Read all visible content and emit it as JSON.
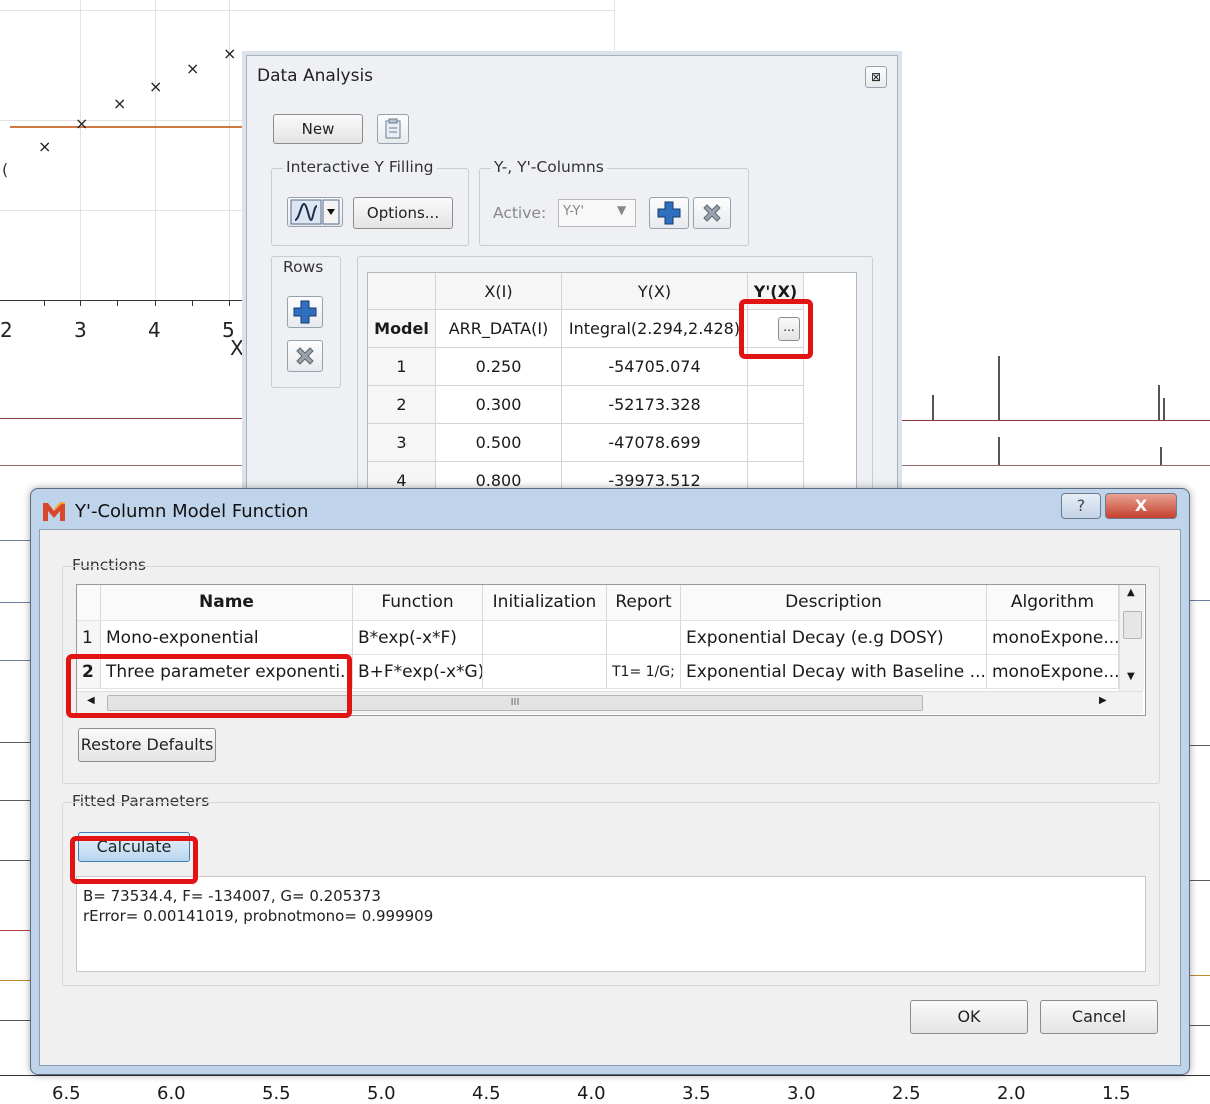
{
  "plot": {
    "x_tick_labels": [
      "2",
      "3",
      "4",
      "5"
    ],
    "x_axis_fragment": "X",
    "left_fragment": "(",
    "bottom_axis_labels": [
      "6.5",
      "6.0",
      "5.5",
      "5.0",
      "4.5",
      "4.0",
      "3.5",
      "3.0",
      "2.5",
      "2.0",
      "1.5"
    ]
  },
  "data_analysis": {
    "title": "Data Analysis",
    "new_button": "New",
    "interactive_y_label": "Interactive Y Filling",
    "options_button": "Options...",
    "yy_columns_label": "Y-, Y'-Columns",
    "active_label": "Active:",
    "active_value": "Y-Y'",
    "rows_label": "Rows",
    "table": {
      "headers": [
        "",
        "X(I)",
        "Y(X)",
        "Y'(X)"
      ],
      "model_row": [
        "Model",
        "ARR_DATA(I)",
        "Integral(2.294,2.428)",
        ""
      ],
      "rows": [
        [
          "1",
          "0.250",
          "-54705.074"
        ],
        [
          "2",
          "0.300",
          "-52173.328"
        ],
        [
          "3",
          "0.500",
          "-47078.699"
        ],
        [
          "4",
          "0.800",
          "-39973.512"
        ]
      ],
      "ellipsis": "..."
    }
  },
  "model_function": {
    "title": "Y'-Column Model Function",
    "help": "?",
    "close": "X",
    "functions_label": "Functions",
    "columns": [
      "Name",
      "Function",
      "Initialization",
      "Report",
      "Description",
      "Algorithm"
    ],
    "rows": [
      {
        "index": "1",
        "name": "Mono-exponential",
        "function": "B*exp(-x*F)",
        "initialization": "",
        "report": "",
        "description": "Exponential Decay (e.g DOSY)",
        "algorithm": "monoExpone..."
      },
      {
        "index": "2",
        "name": "Three parameter exponenti...",
        "function": "B+F*exp(-x*G)",
        "initialization": "",
        "report": "T1= 1/G;",
        "description": "Exponential Decay with Baseline ...",
        "algorithm": "monoExpone..."
      }
    ],
    "scroll_mid": "III",
    "restore_defaults": "Restore Defaults",
    "fitted_label": "Fitted Parameters",
    "calculate": "Calculate",
    "result_line1": "B= 73534.4, F= -134007, G= 0.205373",
    "result_line2": "rError= 0.00141019, probnotmono= 0.999909",
    "ok": "OK",
    "cancel": "Cancel"
  }
}
